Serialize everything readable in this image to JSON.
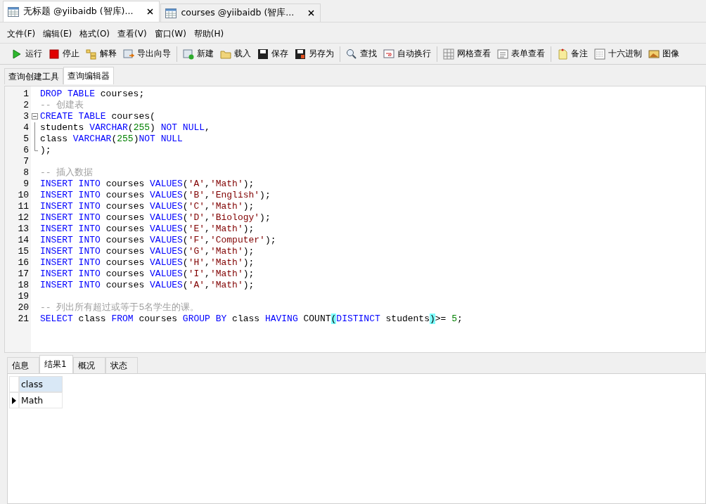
{
  "document_tabs": [
    {
      "label": "无标题 @yiibaidb (智库)...",
      "selected": true
    },
    {
      "label": "courses @yiibaidb (智库...",
      "selected": false
    }
  ],
  "menu": [
    "文件(F)",
    "编辑(E)",
    "格式(O)",
    "查看(V)",
    "窗口(W)",
    "帮助(H)"
  ],
  "toolbar_groups": [
    [
      "运行",
      "停止",
      "解释",
      "导出向导"
    ],
    [
      "新建",
      "载入",
      "保存",
      "另存为"
    ],
    [
      "查找",
      "自动换行"
    ],
    [
      "网格查看",
      "表单查看"
    ],
    [
      "备注",
      "十六进制",
      "图像"
    ]
  ],
  "editor_tabs": [
    {
      "label": "查询创建工具",
      "selected": false
    },
    {
      "label": "查询编辑器",
      "selected": true
    }
  ],
  "code_lines": [
    {
      "number": "1",
      "tokens": [
        {
          "kind": "kw",
          "text": "DROP TABLE"
        },
        {
          "kind": "plain",
          "text": " courses;"
        }
      ]
    },
    {
      "number": "2",
      "tokens": [
        {
          "kind": "comment",
          "text": "-- 创建表"
        }
      ]
    },
    {
      "number": "3",
      "kind": "foldstart",
      "tokens": [
        {
          "kind": "kw",
          "text": "CREATE TABLE"
        },
        {
          "kind": "plain",
          "text": " courses("
        }
      ]
    },
    {
      "number": "4",
      "kind": "foldline",
      "tokens": [
        {
          "kind": "plain",
          "text": "students "
        },
        {
          "kind": "kw",
          "text": "VARCHAR"
        },
        {
          "kind": "plain",
          "text": "("
        },
        {
          "kind": "num",
          "text": "255"
        },
        {
          "kind": "plain",
          "text": ") "
        },
        {
          "kind": "kw",
          "text": "NOT NULL"
        },
        {
          "kind": "plain",
          "text": ","
        }
      ]
    },
    {
      "number": "5",
      "kind": "foldline",
      "tokens": [
        {
          "kind": "plain",
          "text": "class "
        },
        {
          "kind": "kw",
          "text": "VARCHAR"
        },
        {
          "kind": "plain",
          "text": "("
        },
        {
          "kind": "num",
          "text": "255"
        },
        {
          "kind": "plain",
          "text": ")"
        },
        {
          "kind": "kw",
          "text": "NOT NULL"
        }
      ]
    },
    {
      "number": "6",
      "kind": "foldend",
      "tokens": [
        {
          "kind": "plain",
          "text": ");"
        }
      ]
    },
    {
      "number": "7"
    },
    {
      "number": "8",
      "tokens": [
        {
          "kind": "comment",
          "text": "-- 插入数据"
        }
      ]
    },
    {
      "number": "9",
      "tokens": [
        {
          "kind": "kw",
          "text": "INSERT INTO"
        },
        {
          "kind": "plain",
          "text": " courses "
        },
        {
          "kind": "kw",
          "text": "VALUES"
        },
        {
          "kind": "plain",
          "text": "("
        },
        {
          "kind": "str",
          "text": "'A'"
        },
        {
          "kind": "plain",
          "text": ","
        },
        {
          "kind": "str",
          "text": "'Math'"
        },
        {
          "kind": "plain",
          "text": ");"
        }
      ]
    },
    {
      "number": "10",
      "tokens": [
        {
          "kind": "kw",
          "text": "INSERT INTO"
        },
        {
          "kind": "plain",
          "text": " courses "
        },
        {
          "kind": "kw",
          "text": "VALUES"
        },
        {
          "kind": "plain",
          "text": "("
        },
        {
          "kind": "str",
          "text": "'B'"
        },
        {
          "kind": "plain",
          "text": ","
        },
        {
          "kind": "str",
          "text": "'English'"
        },
        {
          "kind": "plain",
          "text": ");"
        }
      ]
    },
    {
      "number": "11",
      "tokens": [
        {
          "kind": "kw",
          "text": "INSERT INTO"
        },
        {
          "kind": "plain",
          "text": " courses "
        },
        {
          "kind": "kw",
          "text": "VALUES"
        },
        {
          "kind": "plain",
          "text": "("
        },
        {
          "kind": "str",
          "text": "'C'"
        },
        {
          "kind": "plain",
          "text": ","
        },
        {
          "kind": "str",
          "text": "'Math'"
        },
        {
          "kind": "plain",
          "text": ");"
        }
      ]
    },
    {
      "number": "12",
      "tokens": [
        {
          "kind": "kw",
          "text": "INSERT INTO"
        },
        {
          "kind": "plain",
          "text": " courses "
        },
        {
          "kind": "kw",
          "text": "VALUES"
        },
        {
          "kind": "plain",
          "text": "("
        },
        {
          "kind": "str",
          "text": "'D'"
        },
        {
          "kind": "plain",
          "text": ","
        },
        {
          "kind": "str",
          "text": "'Biology'"
        },
        {
          "kind": "plain",
          "text": ");"
        }
      ]
    },
    {
      "number": "13",
      "tokens": [
        {
          "kind": "kw",
          "text": "INSERT INTO"
        },
        {
          "kind": "plain",
          "text": " courses "
        },
        {
          "kind": "kw",
          "text": "VALUES"
        },
        {
          "kind": "plain",
          "text": "("
        },
        {
          "kind": "str",
          "text": "'E'"
        },
        {
          "kind": "plain",
          "text": ","
        },
        {
          "kind": "str",
          "text": "'Math'"
        },
        {
          "kind": "plain",
          "text": ");"
        }
      ]
    },
    {
      "number": "14",
      "tokens": [
        {
          "kind": "kw",
          "text": "INSERT INTO"
        },
        {
          "kind": "plain",
          "text": " courses "
        },
        {
          "kind": "kw",
          "text": "VALUES"
        },
        {
          "kind": "plain",
          "text": "("
        },
        {
          "kind": "str",
          "text": "'F'"
        },
        {
          "kind": "plain",
          "text": ","
        },
        {
          "kind": "str",
          "text": "'Computer'"
        },
        {
          "kind": "plain",
          "text": ");"
        }
      ]
    },
    {
      "number": "15",
      "tokens": [
        {
          "kind": "kw",
          "text": "INSERT INTO"
        },
        {
          "kind": "plain",
          "text": " courses "
        },
        {
          "kind": "kw",
          "text": "VALUES"
        },
        {
          "kind": "plain",
          "text": "("
        },
        {
          "kind": "str",
          "text": "'G'"
        },
        {
          "kind": "plain",
          "text": ","
        },
        {
          "kind": "str",
          "text": "'Math'"
        },
        {
          "kind": "plain",
          "text": ");"
        }
      ]
    },
    {
      "number": "16",
      "tokens": [
        {
          "kind": "kw",
          "text": "INSERT INTO"
        },
        {
          "kind": "plain",
          "text": " courses "
        },
        {
          "kind": "kw",
          "text": "VALUES"
        },
        {
          "kind": "plain",
          "text": "("
        },
        {
          "kind": "str",
          "text": "'H'"
        },
        {
          "kind": "plain",
          "text": ","
        },
        {
          "kind": "str",
          "text": "'Math'"
        },
        {
          "kind": "plain",
          "text": ");"
        }
      ]
    },
    {
      "number": "17",
      "tokens": [
        {
          "kind": "kw",
          "text": "INSERT INTO"
        },
        {
          "kind": "plain",
          "text": " courses "
        },
        {
          "kind": "kw",
          "text": "VALUES"
        },
        {
          "kind": "plain",
          "text": "("
        },
        {
          "kind": "str",
          "text": "'I'"
        },
        {
          "kind": "plain",
          "text": ","
        },
        {
          "kind": "str",
          "text": "'Math'"
        },
        {
          "kind": "plain",
          "text": ");"
        }
      ]
    },
    {
      "number": "18",
      "tokens": [
        {
          "kind": "kw",
          "text": "INSERT INTO"
        },
        {
          "kind": "plain",
          "text": " courses "
        },
        {
          "kind": "kw",
          "text": "VALUES"
        },
        {
          "kind": "plain",
          "text": "("
        },
        {
          "kind": "str",
          "text": "'A'"
        },
        {
          "kind": "plain",
          "text": ","
        },
        {
          "kind": "str",
          "text": "'Math'"
        },
        {
          "kind": "plain",
          "text": ");"
        }
      ]
    },
    {
      "number": "19"
    },
    {
      "number": "20",
      "tokens": [
        {
          "kind": "comment",
          "text": "-- 列出所有超过或等于5名学生的课。"
        }
      ]
    },
    {
      "number": "21",
      "tokens": [
        {
          "kind": "kw",
          "text": "SELECT"
        },
        {
          "kind": "plain",
          "text": " class "
        },
        {
          "kind": "kw",
          "text": "FROM"
        },
        {
          "kind": "plain",
          "text": " courses "
        },
        {
          "kind": "kw",
          "text": "GROUP BY"
        },
        {
          "kind": "plain",
          "text": " class "
        },
        {
          "kind": "kw",
          "text": "HAVING"
        },
        {
          "kind": "plain",
          "text": " COUNT"
        },
        {
          "kind": "match",
          "text": "("
        },
        {
          "kind": "kw",
          "text": "DISTINCT"
        },
        {
          "kind": "plain",
          "text": " students"
        },
        {
          "kind": "match",
          "text": ")"
        },
        {
          "kind": "plain",
          "text": ">= "
        },
        {
          "kind": "num",
          "text": "5"
        },
        {
          "kind": "plain",
          "text": ";"
        }
      ]
    }
  ],
  "result_tabs": [
    {
      "label": "信息",
      "selected": false
    },
    {
      "label": "结果1",
      "selected": true
    },
    {
      "label": "概况",
      "selected": false
    },
    {
      "label": "状态",
      "selected": false
    }
  ],
  "result_grid": {
    "columns": [
      "class"
    ],
    "rows": [
      {
        "cells": [
          "Math"
        ],
        "current": true
      }
    ]
  }
}
